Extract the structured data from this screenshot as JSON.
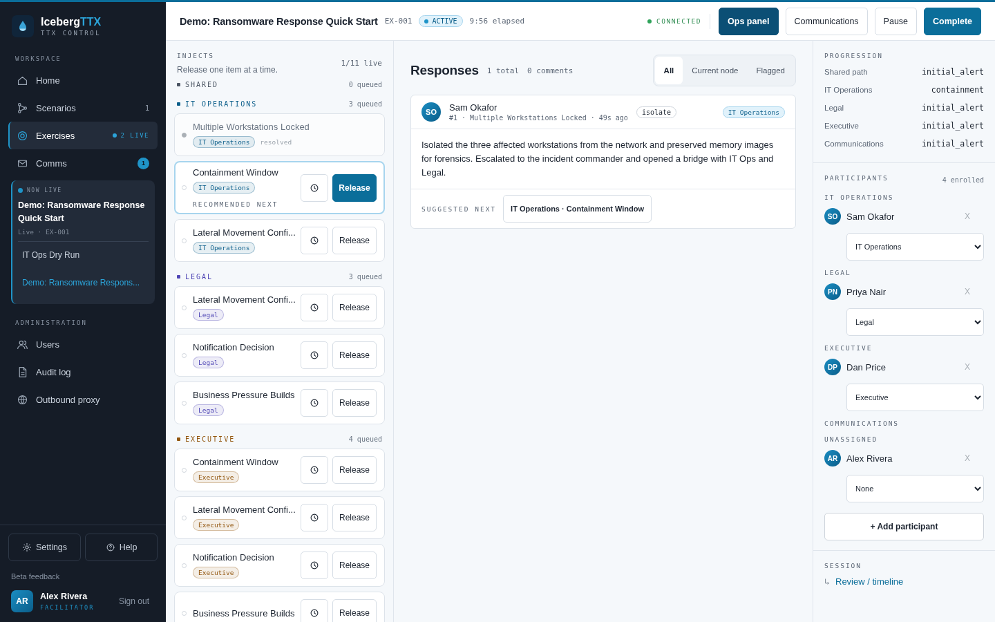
{
  "brand": {
    "name": "Iceberg",
    "accent": "TTX",
    "subtitle": "TTX CONTROL"
  },
  "sidebar": {
    "sections": [
      {
        "label": "WORKSPACE",
        "items": [
          {
            "label": "Home",
            "selected": false
          },
          {
            "label": "Scenarios",
            "selected": false,
            "count": "1"
          },
          {
            "label": "Exercises",
            "selected": true,
            "live": "2 LIVE"
          },
          {
            "label": "Comms",
            "selected": false,
            "badge": "1"
          }
        ]
      },
      {
        "label": "ADMINISTRATION",
        "items": [
          {
            "label": "Users",
            "selected": false
          },
          {
            "label": "Audit log",
            "selected": false
          },
          {
            "label": "Outbound proxy",
            "selected": false
          }
        ]
      }
    ],
    "live_card": {
      "label": "NOW LIVE",
      "title": "Demo: Ransomware Response Quick Start",
      "meta": "Live · EX-001",
      "exercises": [
        {
          "label": "IT Ops Dry Run",
          "selected": false
        },
        {
          "label": "Demo: Ransomware Respons...",
          "selected": true
        }
      ]
    },
    "footer_buttons": [
      {
        "label": "Settings"
      },
      {
        "label": "Help"
      }
    ],
    "feedback": "Beta feedback",
    "user": {
      "initials": "AR",
      "name": "Alex Rivera",
      "role": "FACILITATOR",
      "action": "Sign out"
    }
  },
  "header": {
    "title": "Demo: Ransomware Response Quick Start",
    "code": "EX-001",
    "status": "ACTIVE",
    "elapsed": "9:56 elapsed",
    "connection": "CONNECTED",
    "buttons": [
      {
        "label": "Ops panel",
        "kind": "dark"
      },
      {
        "label": "Communications",
        "kind": "outline"
      },
      {
        "label": "Pause",
        "kind": "outline"
      },
      {
        "label": "Complete",
        "kind": "primary"
      }
    ]
  },
  "injects": {
    "title": "INJECTS",
    "hint": "Release one item at a time.",
    "live": "1/11 live",
    "groups": [
      {
        "label": "SHARED",
        "count": "0 queued",
        "color": "#4b5563"
      },
      {
        "label": "IT OPERATIONS",
        "count": "3 queued",
        "color": "#0b5e8a",
        "items": [
          {
            "title": "Multiple Workstations Locked",
            "tag": "IT Operations",
            "kind": "resolved",
            "status": "resolved"
          },
          {
            "title": "Containment Window",
            "tag": "IT Operations",
            "kind": "recommended",
            "note": "RECOMMENDED NEXT",
            "action": "Release"
          },
          {
            "title": "Lateral Movement Confi...",
            "tag": "IT Operations",
            "kind": "queued",
            "action": "Release"
          }
        ]
      },
      {
        "label": "LEGAL",
        "count": "3 queued",
        "color": "#4f46b5",
        "items": [
          {
            "title": "Lateral Movement Confi...",
            "tag": "Legal",
            "kind": "queued",
            "action": "Release"
          },
          {
            "title": "Notification Decision",
            "tag": "Legal",
            "kind": "queued",
            "action": "Release"
          },
          {
            "title": "Business Pressure Builds",
            "tag": "Legal",
            "kind": "queued",
            "action": "Release"
          }
        ]
      },
      {
        "label": "EXECUTIVE",
        "count": "4 queued",
        "color": "#92560e",
        "items": [
          {
            "title": "Containment Window",
            "tag": "Executive",
            "kind": "queued",
            "action": "Release"
          },
          {
            "title": "Lateral Movement Confi...",
            "tag": "Executive",
            "kind": "queued",
            "action": "Release"
          },
          {
            "title": "Notification Decision",
            "tag": "Executive",
            "kind": "queued",
            "action": "Release"
          },
          {
            "title": "Business Pressure Builds",
            "kind": "queued",
            "action": "Release"
          }
        ]
      }
    ]
  },
  "responses": {
    "title": "Responses",
    "total": "1 total",
    "comments": "0 comments",
    "filters": [
      {
        "label": "All",
        "selected": true
      },
      {
        "label": "Current node",
        "selected": false
      },
      {
        "label": "Flagged",
        "selected": false
      }
    ],
    "items": [
      {
        "initials": "SO",
        "author": "Sam Okafor",
        "meta": "#1 · Multiple Workstations Locked · 49s ago",
        "action_tag": "isolate",
        "team": "IT Operations",
        "body": "Isolated the three affected workstations from the network and preserved memory images for forensics. Escalated to the incident commander and opened a bridge with IT Ops and Legal.",
        "suggested_label": "SUGGESTED NEXT",
        "suggested": "IT Operations · Containment Window"
      }
    ]
  },
  "progression": {
    "title": "PROGRESSION",
    "rows": [
      {
        "team": "Shared path",
        "node": "initial_alert"
      },
      {
        "team": "IT Operations",
        "node": "containment"
      },
      {
        "team": "Legal",
        "node": "initial_alert"
      },
      {
        "team": "Executive",
        "node": "initial_alert"
      },
      {
        "team": "Communications",
        "node": "initial_alert"
      }
    ]
  },
  "participants": {
    "title": "PARTICIPANTS",
    "count": "4 enrolled",
    "groups": [
      {
        "label": "IT OPERATIONS",
        "members": [
          {
            "initials": "SO",
            "name": "Sam Okafor",
            "remove": "X",
            "team": "IT Operations"
          }
        ]
      },
      {
        "label": "LEGAL",
        "members": [
          {
            "initials": "PN",
            "name": "Priya Nair",
            "remove": "X",
            "team": "Legal"
          }
        ]
      },
      {
        "label": "EXECUTIVE",
        "members": [
          {
            "initials": "DP",
            "name": "Dan Price",
            "remove": "X",
            "team": "Executive"
          }
        ]
      },
      {
        "label": "COMMUNICATIONS"
      },
      {
        "label": "UNASSIGNED",
        "members": [
          {
            "initials": "AR",
            "name": "Alex Rivera",
            "remove": "X",
            "team": "None"
          }
        ]
      }
    ],
    "add": "+ Add participant"
  },
  "session": {
    "title": "SESSION",
    "link": "Review / timeline"
  }
}
